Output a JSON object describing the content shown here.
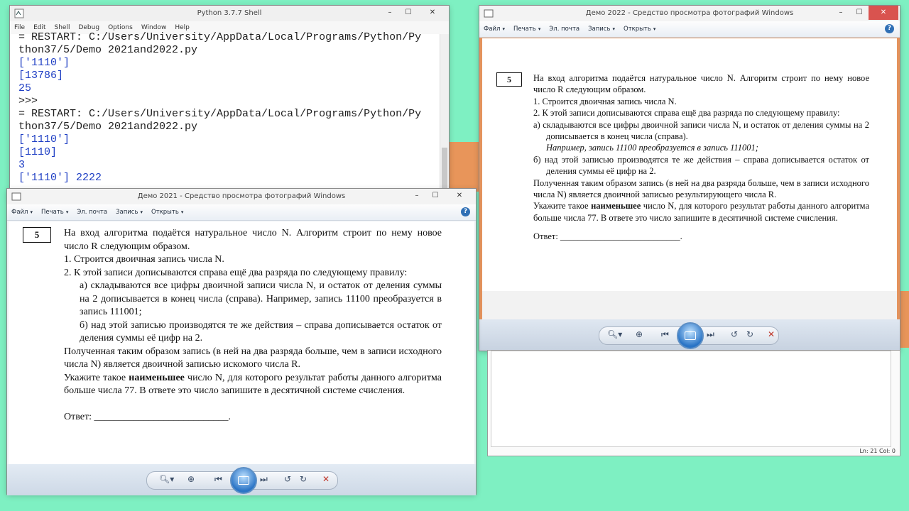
{
  "shell": {
    "title": "Python 3.7.7 Shell",
    "menu": [
      "File",
      "Edit",
      "Shell",
      "Debug",
      "Options",
      "Window",
      "Help"
    ],
    "lines": [
      {
        "t": "= RESTART: C:/Users/University/AppData/Local/Programs/Python/Py",
        "k": "plain"
      },
      {
        "t": "thon37/5/Demo 2021and2022.py",
        "k": "plain"
      },
      {
        "t": "['1110']",
        "k": "out"
      },
      {
        "t": "[13786]",
        "k": "out"
      },
      {
        "t": "25",
        "k": "out"
      },
      {
        "t": ">>>",
        "k": "plain"
      },
      {
        "t": "= RESTART: C:/Users/University/AppData/Local/Programs/Python/Py",
        "k": "plain"
      },
      {
        "t": "thon37/5/Demo 2021and2022.py",
        "k": "plain"
      },
      {
        "t": "['1110']",
        "k": "out"
      },
      {
        "t": "[1110]",
        "k": "out"
      },
      {
        "t": "3",
        "k": "out"
      },
      {
        "t": "['1110'] 2222",
        "k": "out"
      }
    ],
    "status": "Ln: 21   Col: 0"
  },
  "viewer2021": {
    "title": "Демо 2021 - Средство просмотра фотографий Windows",
    "menu": [
      "Файл",
      "Печать",
      "Эл. почта",
      "Запись",
      "Открыть"
    ],
    "task_number": "5",
    "p1": "На вход алгоритма подаётся натуральное число N. Алгоритм строит по нему новое число R следующим образом.",
    "p2": "1. Строится двоичная запись числа N.",
    "p3": "2. К этой записи дописываются справа ещё два разряда по следующему правилу:",
    "p4": "а) складываются все цифры двоичной записи числа N, и остаток от деления суммы на 2 дописывается в конец числа (справа). Например, запись 11100 преобразуется в запись 111001;",
    "p5": "б) над этой записью производятся те же действия – справа дописывается остаток от деления суммы её цифр на 2.",
    "p6": "Полученная таким образом запись (в ней на два разряда больше, чем в записи исходного числа N) является двоичной записью искомого числа R.",
    "p7a": "Укажите такое ",
    "p7b": "наименьшее",
    "p7c": " число N, для которого результат работы данного алгоритма больше числа 77. В ответе это число запишите в десятичной системе счисления.",
    "answer": "Ответ: ___________________________."
  },
  "viewer2022": {
    "title": "Демо 2022 - Средство просмотра фотографий Windows",
    "menu": [
      "Файл",
      "Печать",
      "Эл. почта",
      "Запись",
      "Открыть"
    ],
    "task_number": "5",
    "p1": "На вход алгоритма подаётся натуральное число N. Алгоритм строит по нему новое число R следующим образом.",
    "p2": "1. Строится двоичная запись числа N.",
    "p3": "2. К этой записи дописываются справа ещё два разряда по следующему правилу:",
    "p4": "а)  складываются все цифры двоичной записи числа N, и остаток от деления суммы на 2 дописывается в конец числа (справа).",
    "p4ex": "Например, запись 11100 преобразуется в запись 111001;",
    "p5": "б)  над этой записью производятся те же действия – справа дописывается остаток от деления суммы её цифр на 2.",
    "p6": "Полученная таким образом запись (в ней на два разряда больше, чем в записи исходного числа N) является двоичной записью результирующего числа R.",
    "p7a": "Укажите такое ",
    "p7b": "наименьшее",
    "p7c": " число N, для которого результат работы данного алгоритма больше числа 77. В ответе это число запишите в десятичной системе счисления.",
    "answer": "Ответ: ___________________________."
  },
  "colors": {
    "desktop": "#7ef0c2",
    "accent_orange": "#e8955a",
    "shell_output": "#1f3fc4"
  }
}
